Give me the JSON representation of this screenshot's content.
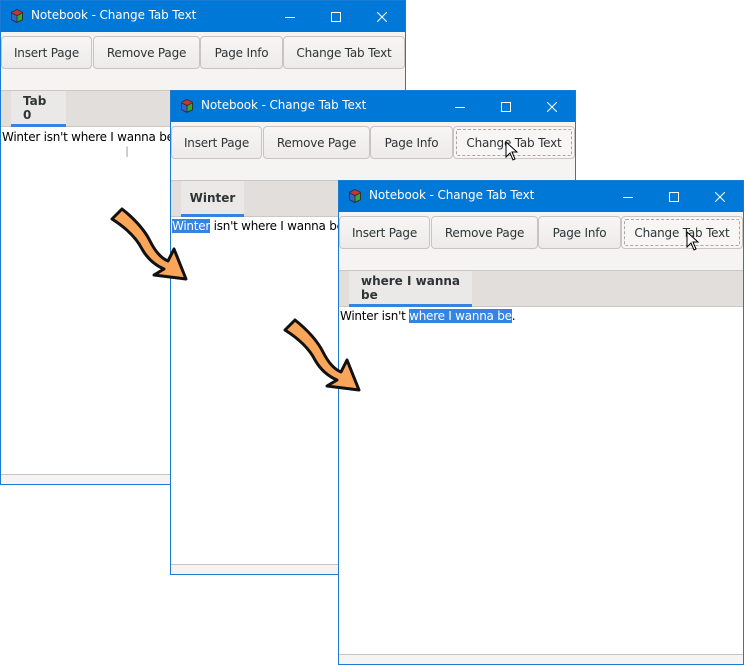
{
  "windows": [
    {
      "title": "Notebook - Change Tab Text",
      "toolbar": [
        "Insert Page",
        "Remove Page",
        "Page Info",
        "Change Tab Text"
      ],
      "tab_label": "Tab 0",
      "text": {
        "before": "Winter isn't where I wanna be.",
        "selected": "",
        "after": ""
      }
    },
    {
      "title": "Notebook - Change Tab Text",
      "toolbar": [
        "Insert Page",
        "Remove Page",
        "Page Info",
        "Change Tab Text"
      ],
      "tab_label": "Winter",
      "text": {
        "before": "",
        "selected": "Winter",
        "after": " isn't where I wanna be."
      }
    },
    {
      "title": "Notebook - Change Tab Text",
      "toolbar": [
        "Insert Page",
        "Remove Page",
        "Page Info",
        "Change Tab Text"
      ],
      "tab_label": "where I wanna be",
      "text": {
        "before": "Winter isn't ",
        "selected": "where I wanna be",
        "after": "."
      }
    }
  ],
  "icons": {
    "app": "gtk-cube-icon",
    "minimize": "minimize-icon",
    "maximize": "maximize-icon",
    "close": "close-icon",
    "step_arrow": "curved-arrow-icon"
  },
  "colors": {
    "titlebar": "#0078d7",
    "selection": "#3584e4",
    "arrow_fill": "#f9a65a"
  }
}
